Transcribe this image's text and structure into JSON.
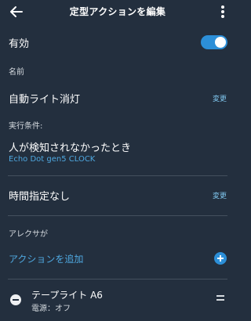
{
  "header": {
    "title": "定型アクションを編集"
  },
  "enabled": {
    "label": "有効",
    "value": true
  },
  "name_section": {
    "label": "名前",
    "value": "自動ライト消灯",
    "edit": "変更"
  },
  "trigger_section": {
    "label": "実行条件:",
    "value": "人が検知されなかったとき",
    "device": "Echo Dot gen5 CLOCK"
  },
  "schedule_section": {
    "value": "時間指定なし",
    "edit": "変更"
  },
  "actions_section": {
    "label": "アレクサが",
    "add": "アクションを追加",
    "items": [
      {
        "name": "テープライト A6",
        "detail": "電源：オフ"
      }
    ]
  },
  "colors": {
    "background": "#232f3e",
    "accent": "#2c8fd8",
    "link": "#4fa8e0"
  },
  "icons": [
    "back-arrow-icon",
    "more-vert-icon",
    "toggle-switch",
    "add-circle-icon",
    "remove-circle-icon",
    "drag-handle-icon"
  ]
}
